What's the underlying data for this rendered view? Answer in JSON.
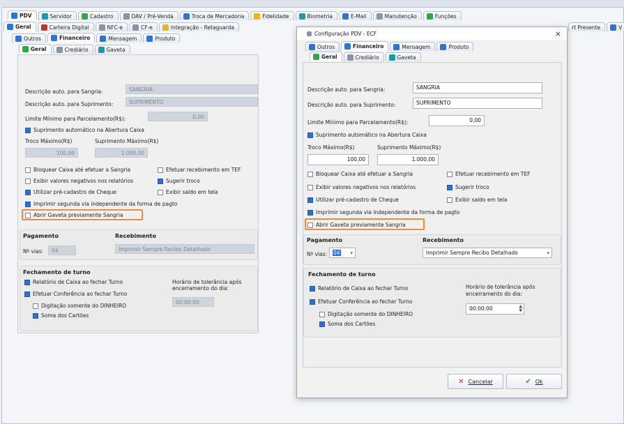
{
  "top_tabs": [
    {
      "label": "PDV",
      "icon": "pdv-icon"
    },
    {
      "label": "Servidor",
      "icon": "server-icon"
    },
    {
      "label": "Cadastro",
      "icon": "register-icon"
    },
    {
      "label": "DAV / Pré-Venda",
      "icon": "document-icon"
    },
    {
      "label": "Troca de Mercadoria",
      "icon": "exchange-icon"
    },
    {
      "label": "Fidelidade",
      "icon": "star-icon"
    },
    {
      "label": "Biometria",
      "icon": "fingerprint-icon"
    },
    {
      "label": "E-Mail",
      "icon": "mail-icon"
    },
    {
      "label": "Manutenção",
      "icon": "wrench-icon"
    },
    {
      "label": "Funções",
      "icon": "functions-icon"
    }
  ],
  "second_tabs": [
    {
      "label": "Geral"
    },
    {
      "label": "Carteira Digital"
    },
    {
      "label": "NFC-e"
    },
    {
      "label": "CF-e"
    },
    {
      "label": "Integração - Retaguarda"
    }
  ],
  "right_tabs": [
    {
      "label": "rt Presente"
    },
    {
      "label": "V"
    }
  ],
  "third_tabs": [
    {
      "label": "Outros"
    },
    {
      "label": "Financeiro"
    },
    {
      "label": "Mensagem"
    },
    {
      "label": "Produto"
    }
  ],
  "fourth_tabs": [
    {
      "label": "Geral"
    },
    {
      "label": "Crediário"
    },
    {
      "label": "Gaveta"
    }
  ],
  "form": {
    "sangria_label": "Descrição auto. para Sangria:",
    "sangria_value": "SANGRIA",
    "suprimento_label": "Descrição auto. para Suprimento:",
    "suprimento_value": "SUPRIMENTO",
    "limite_label": "Limite Mínimo para Parcelamento(R$):",
    "limite_value": "0,00",
    "supr_auto": "Suprimento automático na Abertura Caixa",
    "troco_label": "Troco Máximo(R$)",
    "troco_value": "100,00",
    "supmax_label": "Suprimento Máximo(R$)",
    "supmax_value": "1.000,00",
    "checks": {
      "bloquear": "Bloquear Caixa até efetuar a Sangria",
      "efetuar_tef": "Efetuar recebimento em TEF",
      "exibir_neg": "Exibir valores negativos nos relatórios",
      "sugerir": "Sugerir troco",
      "utilizar": "Utilizar pré-cadastro de Cheque",
      "exibir_saldo": "Exibir saldo em tela",
      "imprimir": "Imprimir segunda via independente da forma de pagto",
      "abrir": "Abrir Gaveta previamente Sangria"
    },
    "pagamento_title": "Pagamento",
    "vias_label": "Nº vias:",
    "vias_value": "04",
    "recebimento_title": "Recebimento",
    "recebimento_value": "Imprimir Sempre Recibo Detalhado",
    "fechamento_title": "Fechamento de turno",
    "relatorio": "Relatório de Caixa ao fechar Turno",
    "conferencia": "Efetuar Conferência ao fechar Turno",
    "digitacao": "Digitação somente do DINHEIRO",
    "soma": "Soma dos Cartões",
    "horario_label": "Horário de tolerância após encerramento do dia:",
    "horario_value": "00:00:00"
  },
  "dialog": {
    "title": "Configuração PDV - ECF",
    "close": "×",
    "imprimir": "Imprimir segunda via independente da forma de pagto",
    "cancel_label": "Cancelar",
    "ok_label": "Ok",
    "vias_value": "04"
  },
  "colors": {
    "highlight": "#f08a3c",
    "checked": "#2f6fd4",
    "disabled_field": "#cfd5dc"
  }
}
